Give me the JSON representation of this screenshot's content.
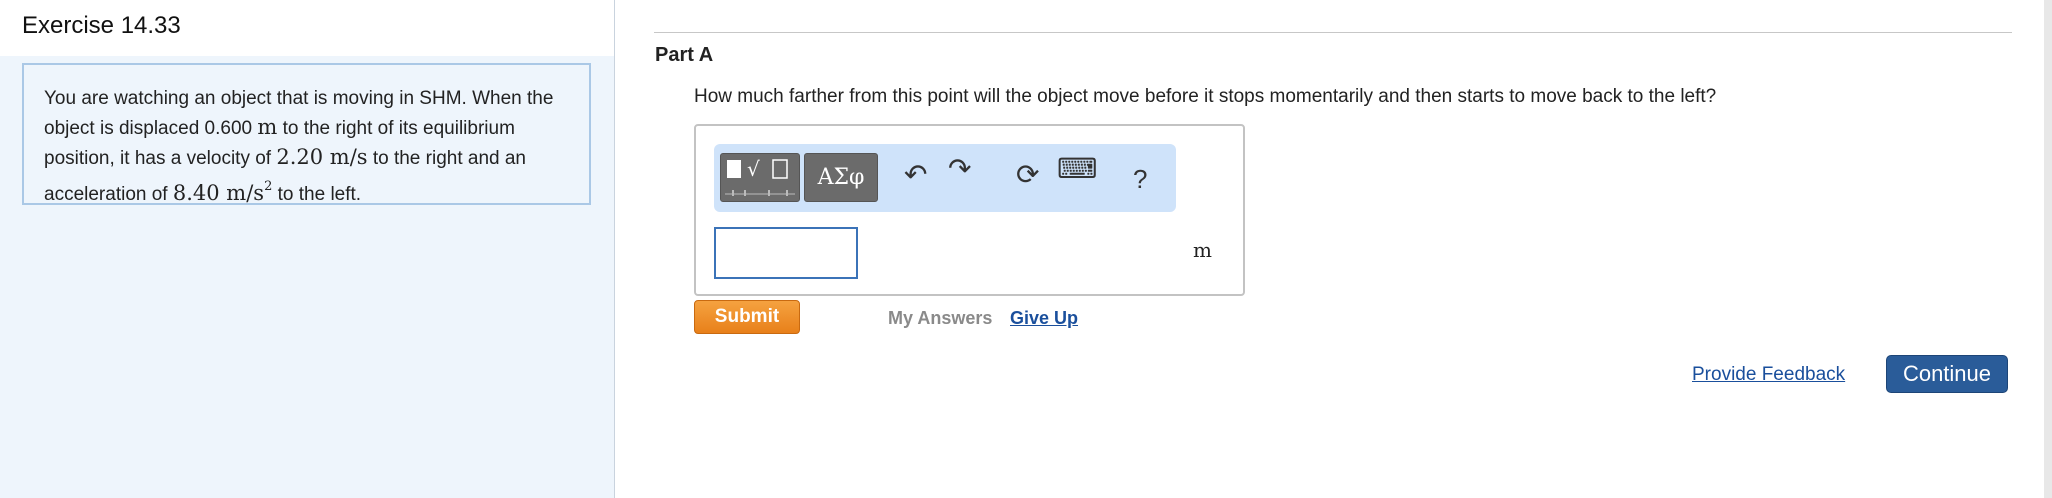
{
  "exercise": {
    "title": "Exercise 14.33"
  },
  "problem": {
    "t1": "You are watching an object that is moving in SHM. When the object is displaced 0.600 ",
    "m1": "m",
    "t2": " to the right of its equilibrium position, it has a velocity of ",
    "m2": "2.20 m/s",
    "t3": " to the right and an acceleration of ",
    "m3": "8.40 m/s",
    "sup": "2",
    "t4": "  to the left."
  },
  "part": {
    "label": "Part A"
  },
  "question": "How much farther from this point will the object move before it stops momentarily and then starts to move back to the left?",
  "toolbar": {
    "templates_glyph": "√",
    "greek_label": "ΑΣφ",
    "undo_icon": "↶",
    "redo_icon": "↷",
    "reset_icon": "⟳",
    "keyboard_icon": "⌨",
    "help_label": "?"
  },
  "answer": {
    "value": "",
    "unit": "m"
  },
  "actions": {
    "submit": "Submit",
    "my_answers": "My Answers",
    "give_up": "Give Up",
    "feedback": "Provide Feedback",
    "continue": "Continue"
  },
  "colors": {
    "submit": "#e8801a",
    "continue": "#2a5c99",
    "link": "#1a4f9c",
    "toolbar_bg": "#cfe3fa"
  }
}
